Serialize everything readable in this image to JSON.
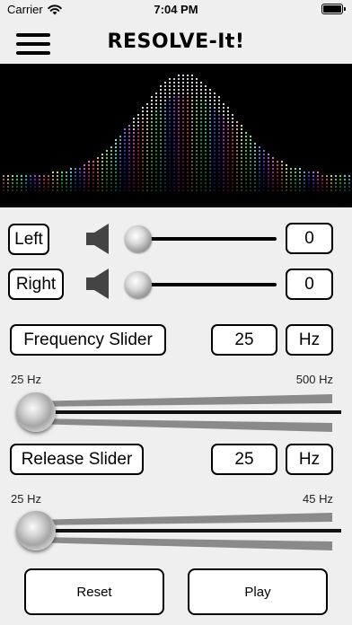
{
  "status_bar": {
    "carrier": "Carrier",
    "time": "7:04 PM"
  },
  "header": {
    "title": "RESOLVE-It!",
    "menu_icon": "hamburger-icon"
  },
  "balance": {
    "left": {
      "label": "Left",
      "value": "0",
      "level": 0
    },
    "right": {
      "label": "Right",
      "value": "0",
      "level": 0
    }
  },
  "frequency": {
    "label": "Frequency Slider",
    "value": "25",
    "unit": "Hz",
    "min_label": "25 Hz",
    "max_label": "500 Hz",
    "level": 0
  },
  "release": {
    "label": "Release Slider",
    "value": "25",
    "unit": "Hz",
    "min_label": "25 Hz",
    "max_label": "45 Hz",
    "level": 0
  },
  "actions": {
    "reset": "Reset",
    "play": "Play"
  }
}
